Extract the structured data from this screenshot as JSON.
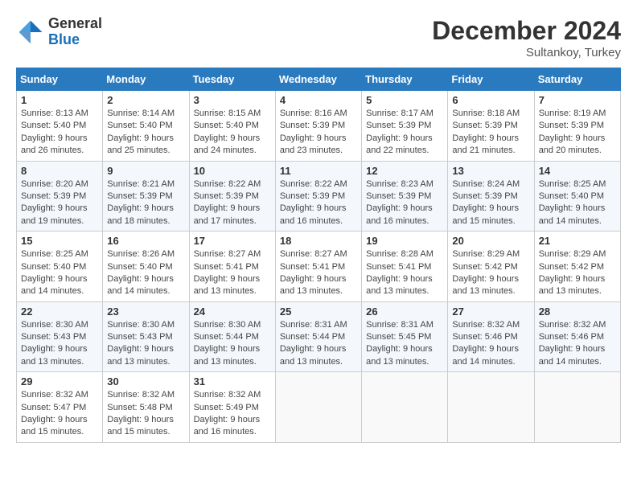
{
  "header": {
    "logo_general": "General",
    "logo_blue": "Blue",
    "month_title": "December 2024",
    "location": "Sultankoy, Turkey"
  },
  "days_of_week": [
    "Sunday",
    "Monday",
    "Tuesday",
    "Wednesday",
    "Thursday",
    "Friday",
    "Saturday"
  ],
  "weeks": [
    [
      {
        "day": "1",
        "sunrise": "8:13 AM",
        "sunset": "5:40 PM",
        "daylight_hours": "9",
        "daylight_minutes": "26"
      },
      {
        "day": "2",
        "sunrise": "8:14 AM",
        "sunset": "5:40 PM",
        "daylight_hours": "9",
        "daylight_minutes": "25"
      },
      {
        "day": "3",
        "sunrise": "8:15 AM",
        "sunset": "5:40 PM",
        "daylight_hours": "9",
        "daylight_minutes": "24"
      },
      {
        "day": "4",
        "sunrise": "8:16 AM",
        "sunset": "5:39 PM",
        "daylight_hours": "9",
        "daylight_minutes": "23"
      },
      {
        "day": "5",
        "sunrise": "8:17 AM",
        "sunset": "5:39 PM",
        "daylight_hours": "9",
        "daylight_minutes": "22"
      },
      {
        "day": "6",
        "sunrise": "8:18 AM",
        "sunset": "5:39 PM",
        "daylight_hours": "9",
        "daylight_minutes": "21"
      },
      {
        "day": "7",
        "sunrise": "8:19 AM",
        "sunset": "5:39 PM",
        "daylight_hours": "9",
        "daylight_minutes": "20"
      }
    ],
    [
      {
        "day": "8",
        "sunrise": "8:20 AM",
        "sunset": "5:39 PM",
        "daylight_hours": "9",
        "daylight_minutes": "19"
      },
      {
        "day": "9",
        "sunrise": "8:21 AM",
        "sunset": "5:39 PM",
        "daylight_hours": "9",
        "daylight_minutes": "18"
      },
      {
        "day": "10",
        "sunrise": "8:22 AM",
        "sunset": "5:39 PM",
        "daylight_hours": "9",
        "daylight_minutes": "17"
      },
      {
        "day": "11",
        "sunrise": "8:22 AM",
        "sunset": "5:39 PM",
        "daylight_hours": "9",
        "daylight_minutes": "16"
      },
      {
        "day": "12",
        "sunrise": "8:23 AM",
        "sunset": "5:39 PM",
        "daylight_hours": "9",
        "daylight_minutes": "16"
      },
      {
        "day": "13",
        "sunrise": "8:24 AM",
        "sunset": "5:39 PM",
        "daylight_hours": "9",
        "daylight_minutes": "15"
      },
      {
        "day": "14",
        "sunrise": "8:25 AM",
        "sunset": "5:40 PM",
        "daylight_hours": "9",
        "daylight_minutes": "14"
      }
    ],
    [
      {
        "day": "15",
        "sunrise": "8:25 AM",
        "sunset": "5:40 PM",
        "daylight_hours": "9",
        "daylight_minutes": "14"
      },
      {
        "day": "16",
        "sunrise": "8:26 AM",
        "sunset": "5:40 PM",
        "daylight_hours": "9",
        "daylight_minutes": "14"
      },
      {
        "day": "17",
        "sunrise": "8:27 AM",
        "sunset": "5:41 PM",
        "daylight_hours": "9",
        "daylight_minutes": "13"
      },
      {
        "day": "18",
        "sunrise": "8:27 AM",
        "sunset": "5:41 PM",
        "daylight_hours": "9",
        "daylight_minutes": "13"
      },
      {
        "day": "19",
        "sunrise": "8:28 AM",
        "sunset": "5:41 PM",
        "daylight_hours": "9",
        "daylight_minutes": "13"
      },
      {
        "day": "20",
        "sunrise": "8:29 AM",
        "sunset": "5:42 PM",
        "daylight_hours": "9",
        "daylight_minutes": "13"
      },
      {
        "day": "21",
        "sunrise": "8:29 AM",
        "sunset": "5:42 PM",
        "daylight_hours": "9",
        "daylight_minutes": "13"
      }
    ],
    [
      {
        "day": "22",
        "sunrise": "8:30 AM",
        "sunset": "5:43 PM",
        "daylight_hours": "9",
        "daylight_minutes": "13"
      },
      {
        "day": "23",
        "sunrise": "8:30 AM",
        "sunset": "5:43 PM",
        "daylight_hours": "9",
        "daylight_minutes": "13"
      },
      {
        "day": "24",
        "sunrise": "8:30 AM",
        "sunset": "5:44 PM",
        "daylight_hours": "9",
        "daylight_minutes": "13"
      },
      {
        "day": "25",
        "sunrise": "8:31 AM",
        "sunset": "5:44 PM",
        "daylight_hours": "9",
        "daylight_minutes": "13"
      },
      {
        "day": "26",
        "sunrise": "8:31 AM",
        "sunset": "5:45 PM",
        "daylight_hours": "9",
        "daylight_minutes": "13"
      },
      {
        "day": "27",
        "sunrise": "8:32 AM",
        "sunset": "5:46 PM",
        "daylight_hours": "9",
        "daylight_minutes": "14"
      },
      {
        "day": "28",
        "sunrise": "8:32 AM",
        "sunset": "5:46 PM",
        "daylight_hours": "9",
        "daylight_minutes": "14"
      }
    ],
    [
      {
        "day": "29",
        "sunrise": "8:32 AM",
        "sunset": "5:47 PM",
        "daylight_hours": "9",
        "daylight_minutes": "15"
      },
      {
        "day": "30",
        "sunrise": "8:32 AM",
        "sunset": "5:48 PM",
        "daylight_hours": "9",
        "daylight_minutes": "15"
      },
      {
        "day": "31",
        "sunrise": "8:32 AM",
        "sunset": "5:49 PM",
        "daylight_hours": "9",
        "daylight_minutes": "16"
      },
      null,
      null,
      null,
      null
    ]
  ],
  "labels": {
    "sunrise": "Sunrise:",
    "sunset": "Sunset:",
    "daylight": "Daylight:",
    "hours_suffix": "hours",
    "and": "and",
    "minutes_suffix": "minutes."
  }
}
